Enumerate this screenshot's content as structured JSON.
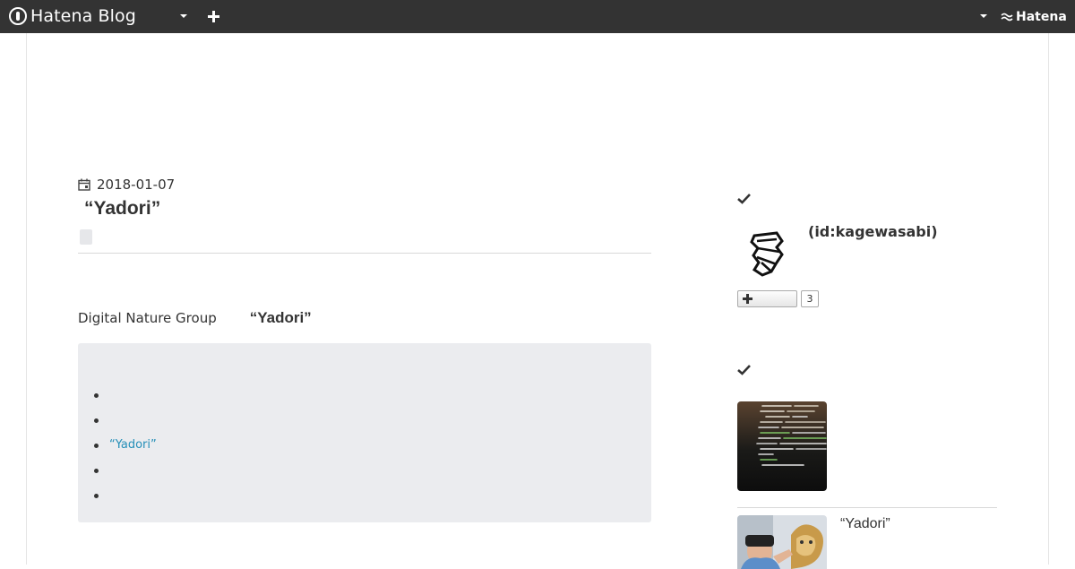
{
  "topbar": {
    "brand": "Hatena Blog",
    "hatena_label": "Hatena"
  },
  "entry": {
    "date": "2018-01-07",
    "title": "“Yadori”",
    "lead_group": "Digital Nature Group",
    "lead_title": "“Yadori”",
    "toc_items": [
      "",
      "",
      "“Yadori”",
      "",
      ""
    ]
  },
  "sidebar": {
    "profile_id": "(id:kagewasabi)",
    "follow_count": "3",
    "related_entry_title": "“Yadori”"
  },
  "colors": {
    "topbar_bg": "#333333",
    "toc_bg": "#ebecef",
    "link": "#258fb8"
  },
  "icons": [
    "hatena-blog-logo-icon",
    "chevron-down-icon",
    "plus-icon",
    "hatena-logo-icon",
    "calendar-icon",
    "check-icon",
    "avatar",
    "plus-icon"
  ]
}
